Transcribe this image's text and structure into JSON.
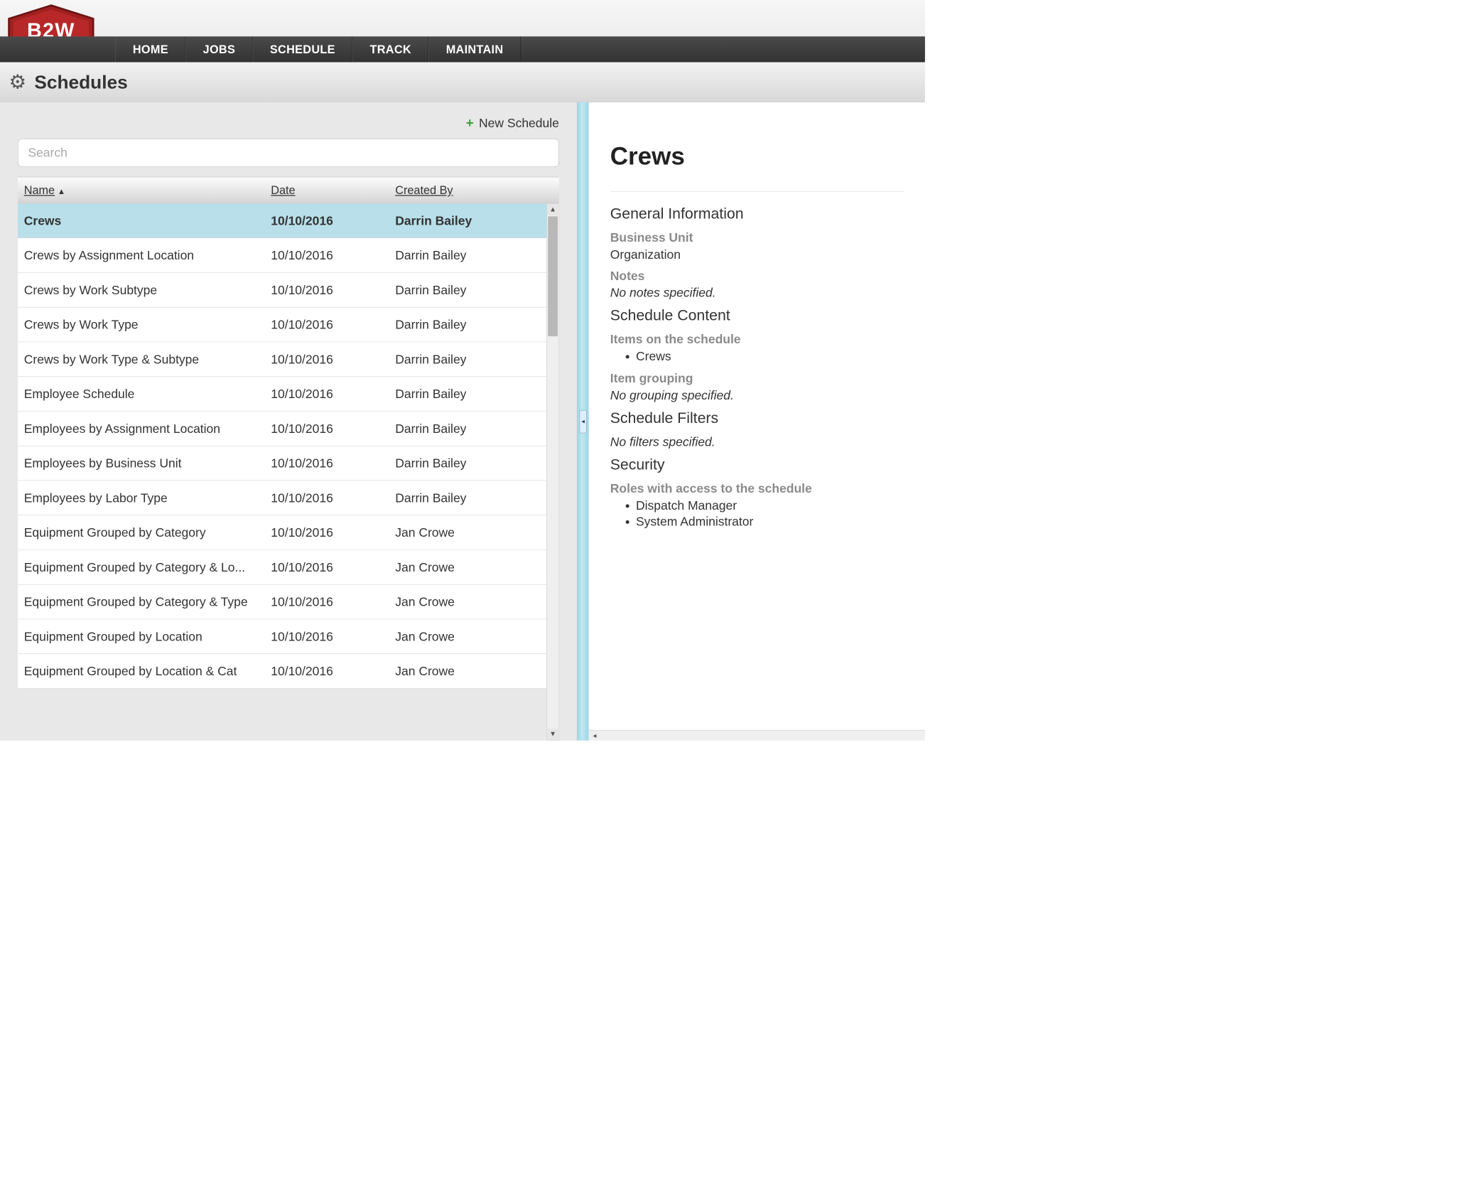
{
  "nav": {
    "items": [
      "HOME",
      "JOBS",
      "SCHEDULE",
      "TRACK",
      "MAINTAIN"
    ]
  },
  "subheader": {
    "title": "Schedules"
  },
  "actions": {
    "new_schedule": "New Schedule"
  },
  "search": {
    "placeholder": "Search",
    "value": ""
  },
  "columns": {
    "name": "Name",
    "date": "Date",
    "created_by": "Created By"
  },
  "rows": [
    {
      "name": "Crews",
      "date": "10/10/2016",
      "created_by": "Darrin Bailey",
      "selected": true
    },
    {
      "name": "Crews by Assignment Location",
      "date": "10/10/2016",
      "created_by": "Darrin Bailey"
    },
    {
      "name": "Crews by Work Subtype",
      "date": "10/10/2016",
      "created_by": "Darrin Bailey"
    },
    {
      "name": "Crews by Work Type",
      "date": "10/10/2016",
      "created_by": "Darrin Bailey"
    },
    {
      "name": "Crews by Work Type & Subtype",
      "date": "10/10/2016",
      "created_by": "Darrin Bailey"
    },
    {
      "name": "Employee Schedule",
      "date": "10/10/2016",
      "created_by": "Darrin Bailey"
    },
    {
      "name": "Employees by Assignment Location",
      "date": "10/10/2016",
      "created_by": "Darrin Bailey"
    },
    {
      "name": "Employees by Business Unit",
      "date": "10/10/2016",
      "created_by": "Darrin Bailey"
    },
    {
      "name": "Employees by Labor Type",
      "date": "10/10/2016",
      "created_by": "Darrin Bailey"
    },
    {
      "name": "Equipment Grouped by Category",
      "date": "10/10/2016",
      "created_by": "Jan Crowe"
    },
    {
      "name": "Equipment Grouped by Category & Lo...",
      "date": "10/10/2016",
      "created_by": "Jan Crowe"
    },
    {
      "name": "Equipment Grouped by Category & Type",
      "date": "10/10/2016",
      "created_by": "Jan Crowe"
    },
    {
      "name": "Equipment Grouped by Location",
      "date": "10/10/2016",
      "created_by": "Jan Crowe"
    },
    {
      "name": "Equipment Grouped by Location & Cat",
      "date": "10/10/2016",
      "created_by": "Jan Crowe"
    }
  ],
  "detail": {
    "title": "Crews",
    "sections": {
      "general": {
        "heading": "General Information",
        "business_unit_label": "Business Unit",
        "business_unit_value": "Organization",
        "notes_label": "Notes",
        "notes_value": "No notes specified."
      },
      "content": {
        "heading": "Schedule Content",
        "items_label": "Items on the schedule",
        "items": [
          "Crews"
        ],
        "grouping_label": "Item grouping",
        "grouping_value": "No grouping specified."
      },
      "filters": {
        "heading": "Schedule Filters",
        "value": "No filters specified."
      },
      "security": {
        "heading": "Security",
        "roles_label": "Roles with access to the schedule",
        "roles": [
          "Dispatch Manager",
          "System Administrator"
        ]
      }
    }
  }
}
